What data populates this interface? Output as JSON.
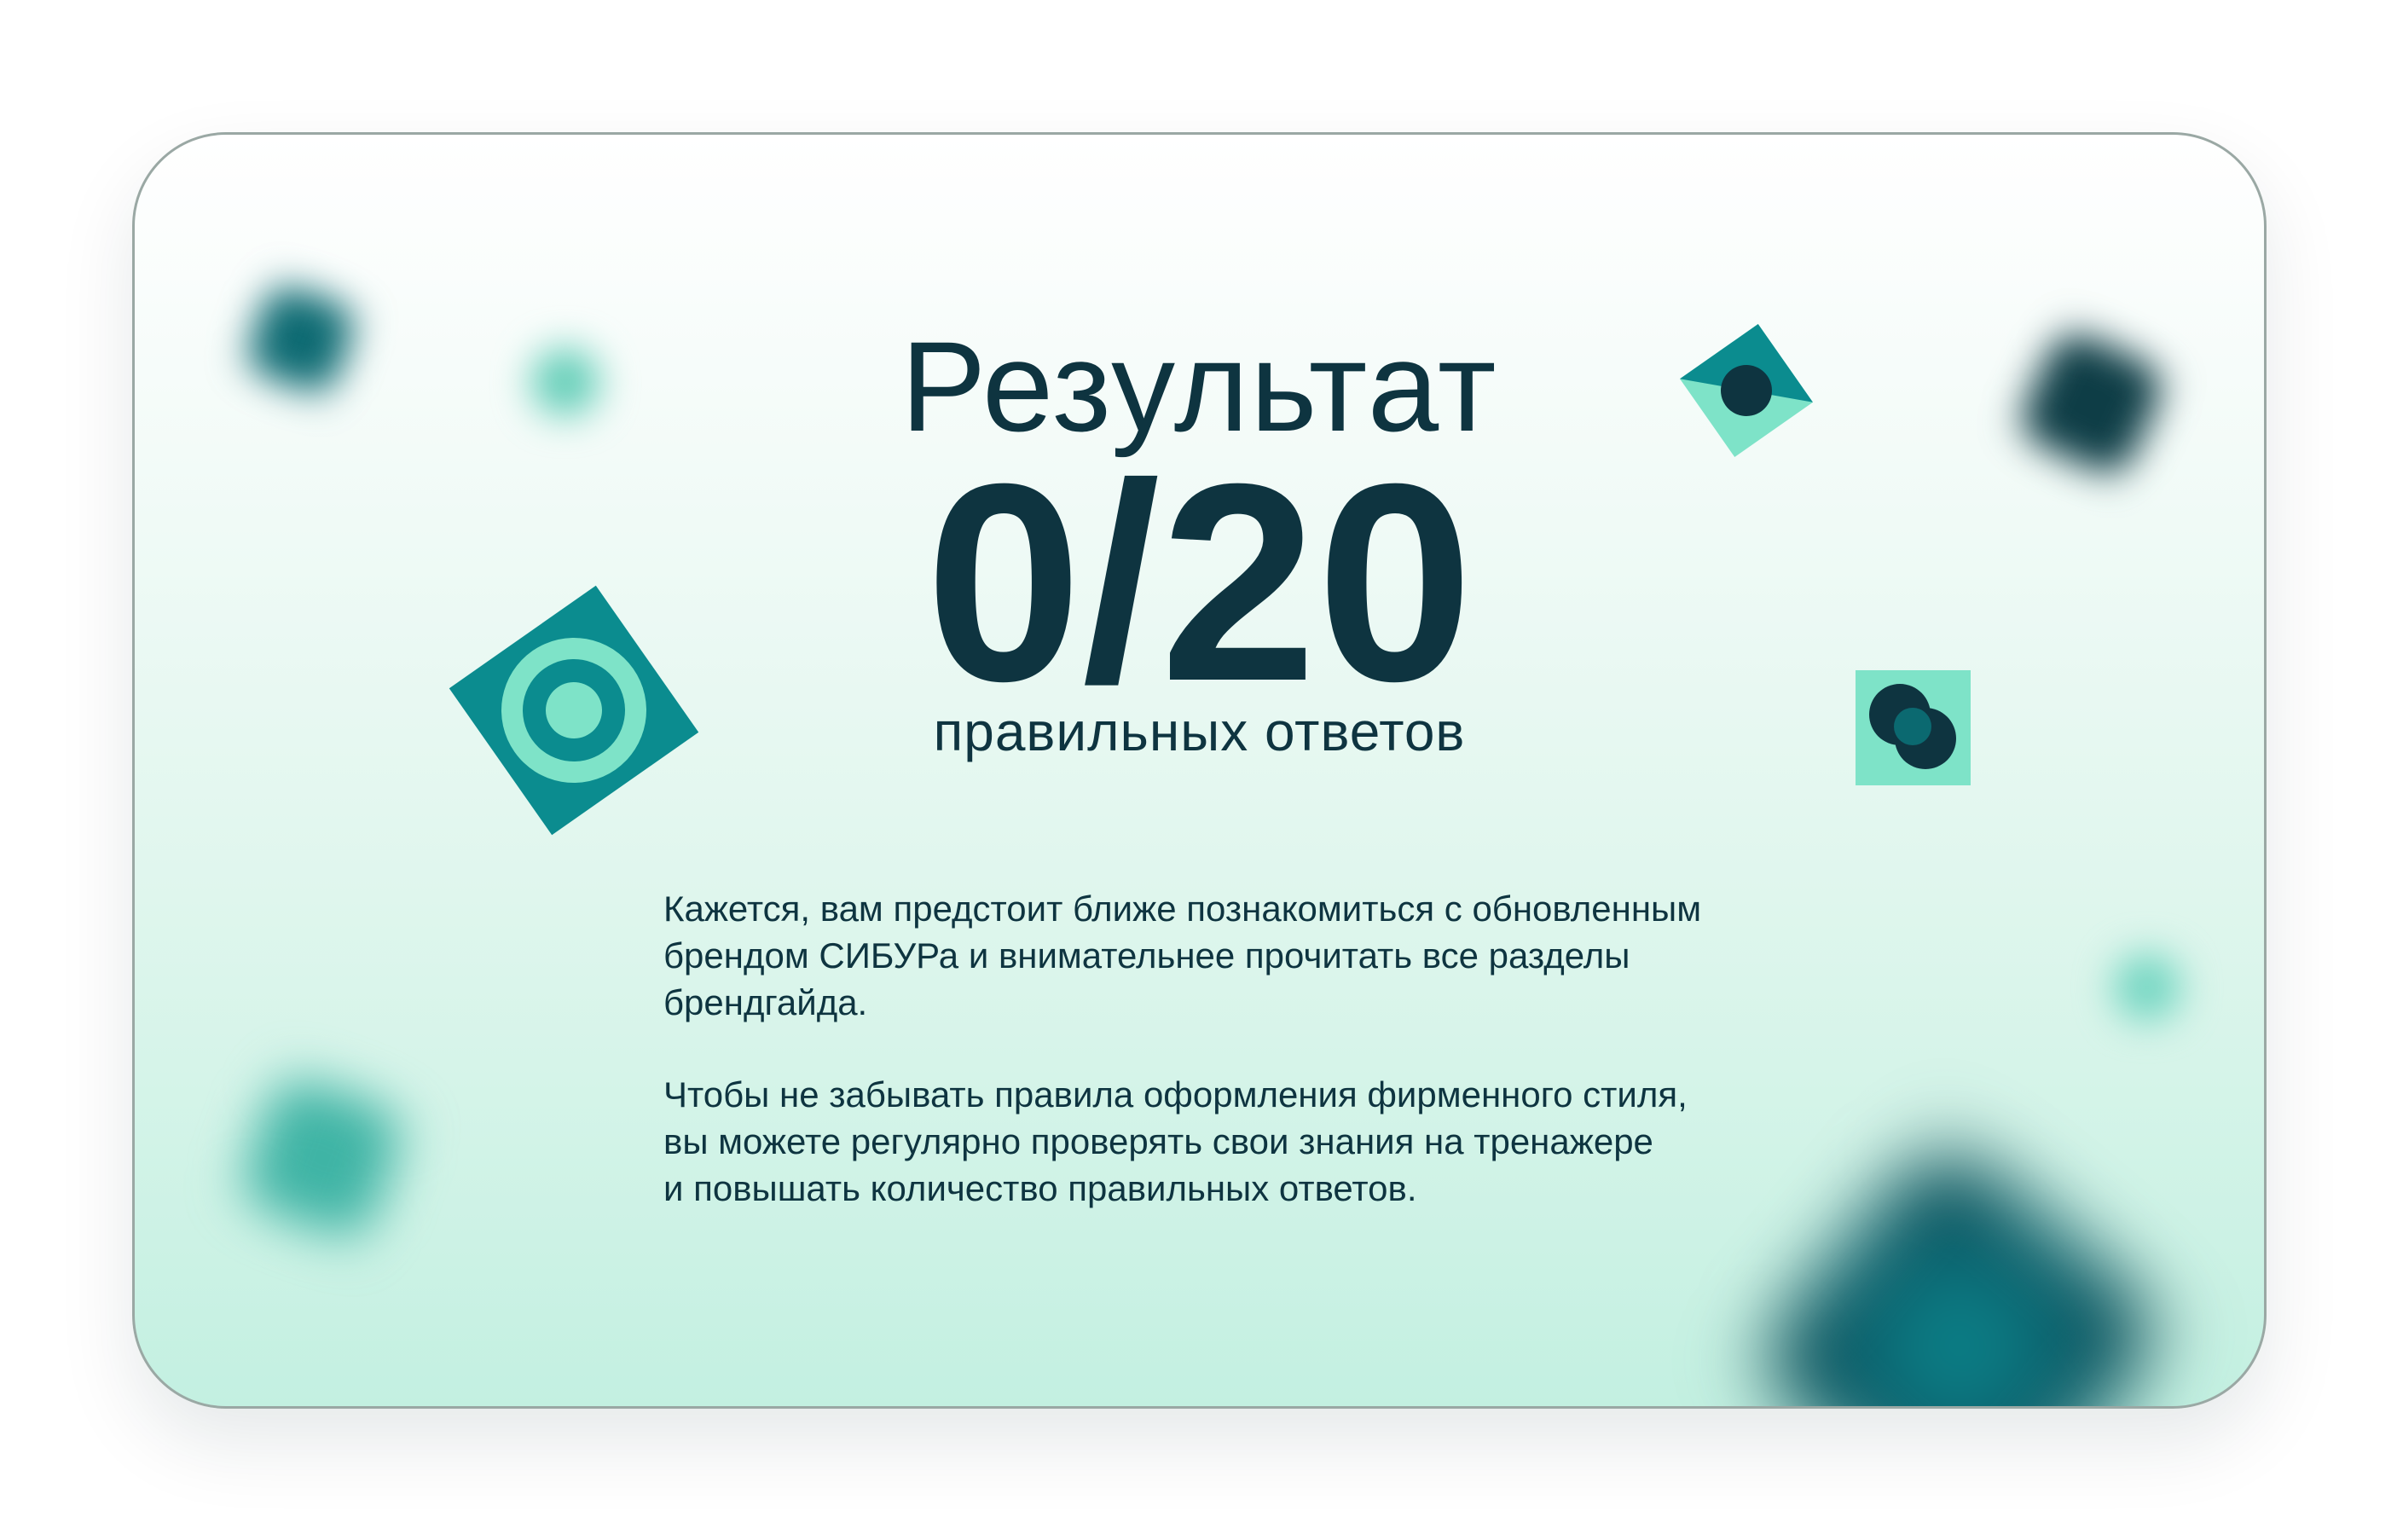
{
  "result": {
    "title": "Результат",
    "score": "0/20",
    "subtitle": "правильных ответов",
    "paragraphs": [
      "Кажется, вам предстоит ближе познакомиться с обновленным\nбрендом СИБУРа и внимательнее прочитать все разделы\nбрендгайда.",
      "Чтобы не забывать правила оформления фирменного стиля,\nвы можете регулярно проверять свои знания на тренажере\nи повышать количество правильных ответов."
    ]
  },
  "colors": {
    "dark": "#0e3440",
    "teal": "#0a8a8e",
    "mint": "#7ee3c8",
    "card_bottom": "#c3f0e1"
  }
}
